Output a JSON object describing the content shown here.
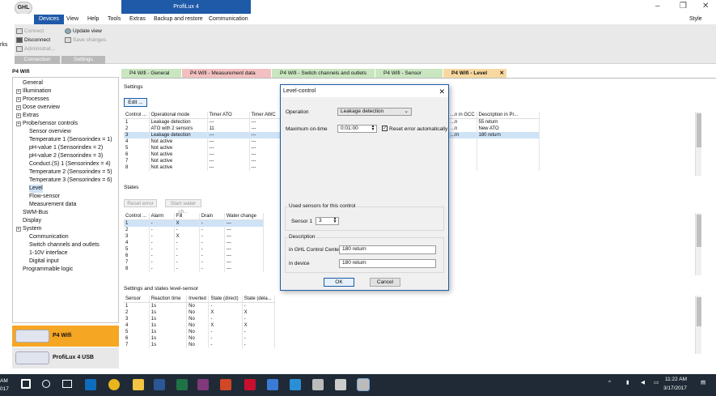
{
  "window": {
    "title": "ProfiLux 4",
    "style_label": "Style"
  },
  "menu": [
    "Devices",
    "View",
    "Help",
    "Tools",
    "Extras",
    "Backup and restore",
    "Communication"
  ],
  "ribbon": {
    "connect": "Connect",
    "disconnect": "Disconnect",
    "administrate": "Administrat...",
    "update_view": "Update view",
    "save_changes": "Save changes",
    "group_connection": "Connection",
    "group_settings": "Settings"
  },
  "left_edge_text": "rks",
  "left_title": "P4 Wifi",
  "tree": [
    {
      "label": "General",
      "indent": 0,
      "expander": false
    },
    {
      "label": "Illumination",
      "indent": 0,
      "expander": true
    },
    {
      "label": "Processes",
      "indent": 0,
      "expander": true
    },
    {
      "label": "Dose overview",
      "indent": 0,
      "expander": true
    },
    {
      "label": "Extras",
      "indent": 0,
      "expander": true
    },
    {
      "label": "Probe/sensor controls",
      "indent": 0,
      "expander": true
    },
    {
      "label": "Sensor overview",
      "indent": 1,
      "expander": false
    },
    {
      "label": "Temperature 1 (Sensorindex = 1)",
      "indent": 1,
      "expander": false
    },
    {
      "label": "pH-value 1 (Sensorindex = 2)",
      "indent": 1,
      "expander": false
    },
    {
      "label": "pH-value 2 (Sensorindex = 3)",
      "indent": 1,
      "expander": false
    },
    {
      "label": "Conduct.(S) 1 (Sensorindex = 4)",
      "indent": 1,
      "expander": false
    },
    {
      "label": "Temperature 2 (Sensorindex = 5)",
      "indent": 1,
      "expander": false
    },
    {
      "label": "Temperature 3 (Sensorindex = 6)",
      "indent": 1,
      "expander": false
    },
    {
      "label": "Level",
      "indent": 1,
      "expander": false
    },
    {
      "label": "Flow-sensor",
      "indent": 1,
      "expander": false
    },
    {
      "label": "Measurement data",
      "indent": 1,
      "expander": false
    },
    {
      "label": "SWM-Bus",
      "indent": 0,
      "expander": false
    },
    {
      "label": "Display",
      "indent": 0,
      "expander": false
    },
    {
      "label": "System",
      "indent": 0,
      "expander": true
    },
    {
      "label": "Communication",
      "indent": 1,
      "expander": false
    },
    {
      "label": "Switch channels and outlets",
      "indent": 1,
      "expander": false
    },
    {
      "label": "1-10V interface",
      "indent": 1,
      "expander": false
    },
    {
      "label": "Digital input",
      "indent": 1,
      "expander": false
    },
    {
      "label": "Programmable logic",
      "indent": 0,
      "expander": false
    }
  ],
  "devices": [
    "P4 Wifi",
    "ProfiLux 4 USB"
  ],
  "tabs": [
    {
      "label": "P4 Wifi - General",
      "color": "#c9e6c0"
    },
    {
      "label": "P4 Wifi - Measurement data",
      "color": "#f2c0c0"
    },
    {
      "label": "P4 Wifi - Switch channels and outlets",
      "color": "#c9e6c0"
    },
    {
      "label": "P4 Wifi - Sensor overview",
      "color": "#c9e6c0"
    },
    {
      "label": "P4 Wifi - Level",
      "color": "#f8d8a0",
      "close": "✕"
    }
  ],
  "settings": {
    "title": "Settings",
    "edit": "Edit ...",
    "headers": [
      "Control ...",
      "Operational mode",
      "Timer ATO",
      "Timer AWC"
    ],
    "headers_right": [
      "...n in GCC",
      "Description in Pr..."
    ],
    "rows": [
      [
        "1",
        "Leakage detection",
        "---",
        "---"
      ],
      [
        "2",
        "ATO with 2 sensors",
        "11",
        "---"
      ],
      [
        "3",
        "Leakage detection",
        "---",
        "---"
      ],
      [
        "4",
        "Not active",
        "---",
        "---"
      ],
      [
        "5",
        "Not active",
        "---",
        "---"
      ],
      [
        "6",
        "Not active",
        "---",
        "---"
      ],
      [
        "7",
        "Not active",
        "---",
        "---"
      ],
      [
        "8",
        "Not active",
        "---",
        "---"
      ]
    ],
    "rows_right": [
      [
        "...n",
        "55 return"
      ],
      [
        "...n",
        "New ATO"
      ],
      [
        "...rn",
        "180 return"
      ],
      [
        "",
        ""
      ],
      [
        "",
        ""
      ],
      [
        "",
        ""
      ],
      [
        "",
        ""
      ],
      [
        "",
        ""
      ]
    ]
  },
  "states": {
    "title": "States",
    "reset_error": "Reset error",
    "start_water": "Start water ch...",
    "headers": [
      "Control ...",
      "Alarm",
      "Fill",
      "Drain",
      "Water change"
    ],
    "rows": [
      [
        "1",
        "-",
        "X",
        "-",
        "---"
      ],
      [
        "2",
        "-",
        "-",
        "-",
        "---"
      ],
      [
        "3",
        "-",
        "X",
        "-",
        "---"
      ],
      [
        "4",
        "-",
        "-",
        "-",
        "---"
      ],
      [
        "5",
        "-",
        "-",
        "-",
        "---"
      ],
      [
        "6",
        "-",
        "-",
        "-",
        "---"
      ],
      [
        "7",
        "-",
        "-",
        "-",
        "---"
      ],
      [
        "8",
        "-",
        "-",
        "-",
        "---"
      ]
    ]
  },
  "level_sensor": {
    "title": "Settings and states level-sensor",
    "headers": [
      "Sensor",
      "Reaction time",
      "Inverted",
      "State (direct)",
      "State (dela..."
    ],
    "rows": [
      [
        "1",
        "1s",
        "No",
        "-",
        "-"
      ],
      [
        "2",
        "1s",
        "No",
        "X",
        "X"
      ],
      [
        "3",
        "1s",
        "No",
        "-",
        "-"
      ],
      [
        "4",
        "1s",
        "No",
        "X",
        "X"
      ],
      [
        "5",
        "1s",
        "No",
        "-",
        "-"
      ],
      [
        "6",
        "1s",
        "No",
        "-",
        "-"
      ],
      [
        "7",
        "1s",
        "No",
        "-",
        "-"
      ]
    ]
  },
  "dialog": {
    "title": "Level-control",
    "close": "✕",
    "operation_label": "Operation",
    "operation_value": "Leakage detection",
    "max_on_label": "Maximum on-time",
    "max_on_value": "0:01:00",
    "reset_auto_label": "Reset error automatically",
    "reset_auto_checked": "✓",
    "used_sensors_title": "Used sensors for this control",
    "sensor1_label": "Sensor 1",
    "sensor1_value": "3",
    "description_title": "Description",
    "gcc_label": "in GHL Control Center",
    "gcc_value": "180 return",
    "device_label": "in device",
    "device_value": "180 return",
    "ok": "OK",
    "cancel": "Cancel"
  },
  "taskbar": {
    "left_clip_top": "AM",
    "left_clip_bottom": "017",
    "time": "11:22 AM",
    "date": "3/17/2017"
  }
}
